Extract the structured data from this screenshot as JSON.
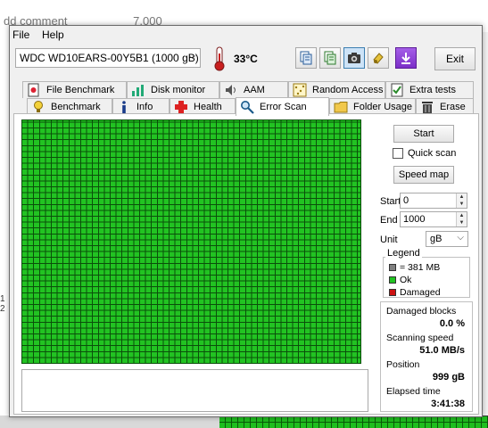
{
  "background": {
    "top_text": "dd comment",
    "top_value": "7,000",
    "left_edge_text": "1 2"
  },
  "menu": {
    "file": "File",
    "help": "Help"
  },
  "toolbar": {
    "drive": "WDC WD10EARS-00Y5B1 (1000 gB)",
    "temperature": "33°C",
    "exit": "Exit",
    "icons": [
      "copy-text-icon",
      "copy-info-icon",
      "screenshot-camera-icon",
      "save-options-icon",
      "download-arrow-icon"
    ]
  },
  "tabs_row1": [
    "File Benchmark",
    "Disk monitor",
    "AAM",
    "Random Access",
    "Extra tests"
  ],
  "tabs_row2": [
    "Benchmark",
    "Info",
    "Health",
    "Error Scan",
    "Folder Usage",
    "Erase"
  ],
  "active_tab": "Error Scan",
  "controls": {
    "start_button": "Start",
    "quick_scan": "Quick scan",
    "quick_scan_checked": false,
    "speed_map_button": "Speed map",
    "start_label": "Start",
    "start_value": "0",
    "end_label": "End",
    "end_value": "1000",
    "unit_label": "Unit",
    "unit_value": "gB"
  },
  "legend": {
    "title": "Legend",
    "items": [
      {
        "label": "= 381 MB",
        "color": "#808080"
      },
      {
        "label": "Ok",
        "color": "#22c322"
      },
      {
        "label": "Damaged",
        "color": "#cc1111"
      }
    ]
  },
  "stats": {
    "damaged_blocks_label": "Damaged blocks",
    "damaged_blocks_value": "0.0 %",
    "scanning_speed_label": "Scanning speed",
    "scanning_speed_value": "51.0 MB/s",
    "position_label": "Position",
    "position_value": "999 gB",
    "elapsed_label": "Elapsed time",
    "elapsed_value": "3:41:38"
  },
  "colors": {
    "ok_green": "#22c322",
    "grid_line": "#0b4f0b",
    "damaged_red": "#cc1111"
  }
}
